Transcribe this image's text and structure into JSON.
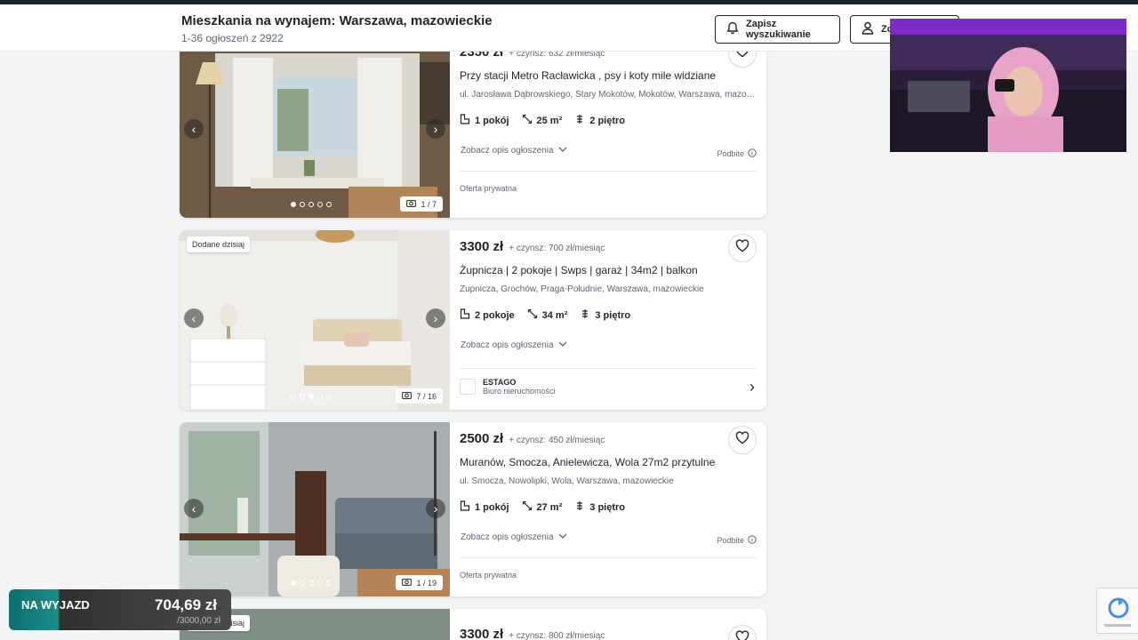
{
  "header": {
    "title": "Mieszkania na wynajem: Warszawa, mazowieckie",
    "count_text": "1-36 ogłoszeń z 2922",
    "save_search_label": "Zapisz wyszukiwanie",
    "second_button_label": "Zo"
  },
  "listings": [
    {
      "price": "2350 zł",
      "rent": "+ czynsz: 632 zł/miesiąc",
      "title": "Przy stacji Metro Racławicka , psy i koty mile widziane",
      "address": "ul. Jarosława Dąbrowskiego, Stary Mokotów, Mokotów, Warszawa, mazowieckie",
      "rooms": "1 pokój",
      "area": "25 m²",
      "floor": "2 piętro",
      "desc_label": "Zobacz opis ogłoszenia",
      "boost_label": "Podbite",
      "seller": "Oferta prywatna",
      "photo_counter": "1 / 7",
      "photo_dots": 5,
      "photo_active": 0
    },
    {
      "badge": "Dodane dzisiaj",
      "price": "3300 zł",
      "rent": "+ czynsz: 700 zł/miesiąc",
      "title": "Żupnicza | 2 pokoje | Swps | garaż | 34m2 | balkon",
      "address": "Żupnicza, Grochów, Praga-Południe, Warszawa, mazowieckie",
      "rooms": "2 pokoje",
      "area": "34 m²",
      "floor": "3 piętro",
      "desc_label": "Zobacz opis ogłoszenia",
      "agency_name": "ESTAGO",
      "agency_kind": "Biuro nieruchomości",
      "photo_counter": "7 / 16",
      "photo_dots": 5,
      "photo_active": 2
    },
    {
      "price": "2500 zł",
      "rent": "+ czynsz: 450 zł/miesiąc",
      "title": "Muranów, Smocza, Anielewicza, Wola 27m2 przytulne",
      "address": "ul. Smocza, Nowolipki, Wola, Warszawa, mazowieckie",
      "rooms": "1 pokój",
      "area": "27 m²",
      "floor": "3 piętro",
      "desc_label": "Zobacz opis ogłoszenia",
      "boost_label": "Podbite",
      "seller": "Oferta prywatna",
      "photo_counter": "1 / 19",
      "photo_dots": 5,
      "photo_active": 0
    },
    {
      "badge": "Dodane dzisiaj",
      "price": "3300 zł",
      "rent": "+ czynsz: 800 zł/miesiąc"
    }
  ],
  "overlay": {
    "donation_label": "NA WYJAZD",
    "donation_amount": "704,69 zł",
    "donation_goal": "/3000,00 zł"
  },
  "colors": {
    "page_bg": "#f2f4f5",
    "accent_dark": "#1f2328",
    "muted_text": "#5c6670"
  }
}
